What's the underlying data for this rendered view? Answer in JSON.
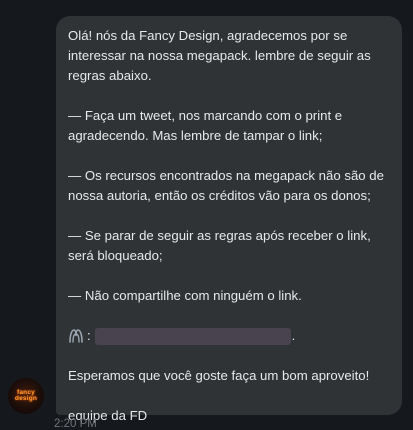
{
  "message": {
    "paragraphs": [
      "Olá! nós da Fancy Design, agradecemos por se interessar na nossa megapack. lembre de seguir as regras abaixo.",
      "— Faça um tweet, nos marcando com o print e agradecendo. Mas lembre de tampar o link;",
      "— Os recursos encontrados na megapack não são de nossa autoria, então os créditos vão para os donos;",
      "— Se parar de seguir as regras após receber o link, será bloqueado;",
      "— Não compartilhe com ninguém o link."
    ],
    "link_colon": ":",
    "link_trailing": ".",
    "closing": "Esperamos que você goste faça um bom aproveito!",
    "signature": "equipe da FD"
  },
  "sender": {
    "avatar_text": "fancy design"
  },
  "timestamp": "2:20 PM",
  "colors": {
    "background": "#15181c",
    "bubble": "#2f3336",
    "text": "#e7e9ea",
    "timestamp": "#71767b",
    "avatar_accent": "#ff9a2e"
  },
  "icons": {
    "link_icon": "mega-logo-icon"
  }
}
